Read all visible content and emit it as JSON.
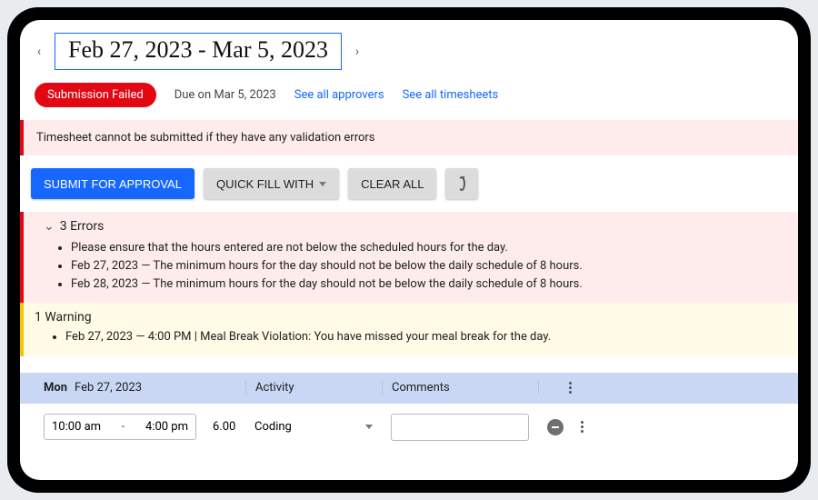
{
  "dateRange": "Feb 27, 2023 - Mar 5, 2023",
  "status": {
    "badge": "Submission Failed",
    "dueText": "Due on Mar 5, 2023",
    "approversLink": "See all approvers",
    "timesheetsLink": "See all timesheets"
  },
  "bannerError": "Timesheet cannot be submitted if they have any validation errors",
  "actions": {
    "submit": "SUBMIT FOR APPROVAL",
    "quickFill": "QUICK FILL WITH",
    "clearAll": "CLEAR ALL"
  },
  "errors": {
    "header": "3 Errors",
    "items": [
      "Please ensure that the hours entered are not below the scheduled hours for the day.",
      "Feb 27, 2023 — The minimum hours for the day should not be below the daily schedule of 8 hours.",
      "Feb 28, 2023 — The minimum hours for the day should not be below the daily schedule of 8 hours."
    ]
  },
  "warnings": {
    "header": "1 Warning",
    "items": [
      "Feb 27, 2023 — 4:00 PM | Meal Break Violation: You have missed your meal break for the day."
    ]
  },
  "grid": {
    "headers": {
      "dayAbbr": "Mon",
      "dayDate": "Feb 27, 2023",
      "activity": "Activity",
      "comments": "Comments"
    },
    "row": {
      "timeStart": "10:00 am",
      "timeEnd": "4:00 pm",
      "hours": "6.00",
      "activity": "Coding",
      "comments": ""
    }
  }
}
